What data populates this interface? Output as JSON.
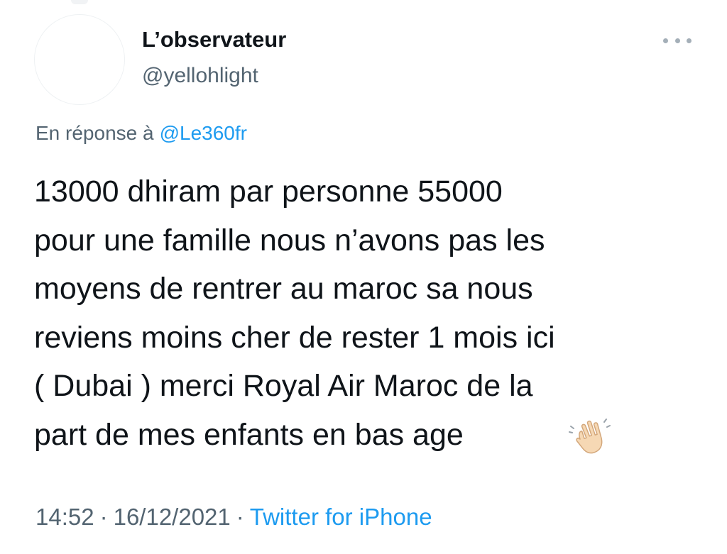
{
  "user": {
    "display_name": "L’observateur",
    "handle": "@yellohlight"
  },
  "reply": {
    "prefix": "En réponse à",
    "mention": "@Le360fr"
  },
  "tweet": {
    "text": "13000 dhiram par personne 55000\npour une famille nous n’avons pas les\nmoyens de rentrer au maroc sa nous\nreviens moins cher de rester 1 mois ici\n( Dubai ) merci Royal Air Maroc de la\npart de mes enfants en bas age",
    "emoji_icon": "waving-hand-icon"
  },
  "meta": {
    "time": "14:52",
    "separator": "·",
    "date": "16/12/2021",
    "source": "Twitter for iPhone"
  },
  "colors": {
    "text": "#0f1419",
    "secondary": "#536471",
    "link": "#1d9bf0"
  },
  "icons": {
    "more": "more-dots-icon",
    "avatar": "avatar"
  }
}
